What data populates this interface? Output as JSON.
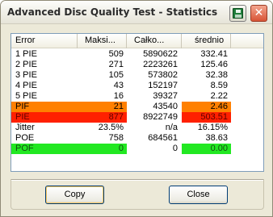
{
  "window": {
    "title": "Advanced Disc Quality Test - Statistics",
    "close_glyph": "✕"
  },
  "table": {
    "headers": {
      "error": "Error",
      "max": "Maksi...",
      "total": "Całko...",
      "avg": "średnio"
    },
    "rows": [
      {
        "name": "1 PIE",
        "max": "509",
        "total": "5890622",
        "avg": "332.41",
        "highlight": ""
      },
      {
        "name": "2 PIE",
        "max": "271",
        "total": "2223261",
        "avg": "125.46",
        "highlight": ""
      },
      {
        "name": "3 PIE",
        "max": "105",
        "total": "573802",
        "avg": "32.38",
        "highlight": ""
      },
      {
        "name": "4 PIE",
        "max": "43",
        "total": "152197",
        "avg": "8.59",
        "highlight": ""
      },
      {
        "name": "5 PIE",
        "max": "16",
        "total": "39327",
        "avg": "2.22",
        "highlight": ""
      },
      {
        "name": "PIF",
        "max": "21",
        "total": "43540",
        "avg": "2.46",
        "highlight": "orange"
      },
      {
        "name": "PIE",
        "max": "877",
        "total": "8922749",
        "avg": "503.51",
        "highlight": "red"
      },
      {
        "name": "Jitter",
        "max": "23.5%",
        "total": "n/a",
        "avg": "16.15%",
        "highlight": ""
      },
      {
        "name": "POE",
        "max": "758",
        "total": "684561",
        "avg": "38.63",
        "highlight": ""
      },
      {
        "name": "POF",
        "max": "0",
        "total": "0",
        "avg": "0.00",
        "highlight": "green"
      }
    ]
  },
  "buttons": {
    "copy": "Copy",
    "close": "Close"
  },
  "colors": {
    "orange": "#ff8000",
    "red": "#ff2000",
    "green": "#22e822"
  }
}
